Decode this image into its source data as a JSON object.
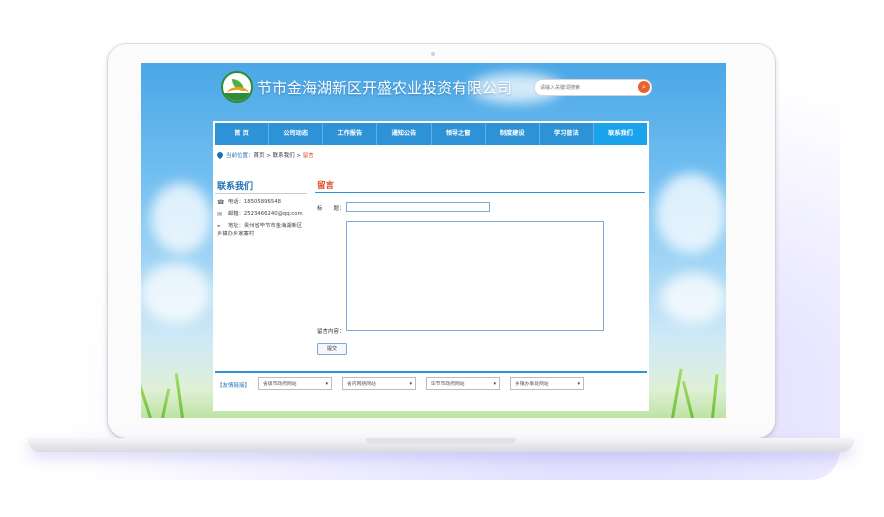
{
  "site": {
    "title": "节市金海湖新区开盛农业投资有限公司",
    "search_placeholder": "请输入关键词搜索"
  },
  "nav": {
    "items": [
      "首 页",
      "公司动态",
      "工作报告",
      "通知公告",
      "领导之窗",
      "制度建设",
      "学习普法",
      "联系我们"
    ],
    "active_index": 7
  },
  "breadcrumb": {
    "label": "当前位置：",
    "path": "首页 > 联系我们 > ",
    "current": "留言"
  },
  "sidebar": {
    "title": "联系我们",
    "phone": "电话：18505896548",
    "email": "邮箱：2523466240@qq.com",
    "address": "地址：贵州省毕节市金海湖新区乡镇办乡家寨村"
  },
  "form": {
    "heading": "留言",
    "title_label": "标　　题：",
    "title_value": "",
    "content_label": "留言内容：",
    "content_value": "",
    "submit_label": "提交"
  },
  "footer": {
    "links_label": "【友情链接】",
    "selects": [
      "省级市政府网站",
      "省内网络网站",
      "毕节市政府网站",
      "乡镇办事处网站"
    ]
  },
  "colors": {
    "nav_bg": "#2e92d6",
    "nav_active": "#1aa3ec",
    "accent_orange": "#e04a22",
    "link_blue": "#1f6fb5"
  }
}
